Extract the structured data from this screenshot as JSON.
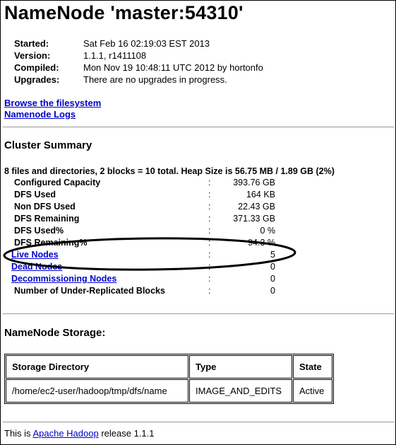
{
  "title": "NameNode 'master:54310'",
  "info": [
    {
      "key": "Started:",
      "value": "Sat Feb 16 02:19:03 EST 2013"
    },
    {
      "key": "Version:",
      "value": "1.1.1, r1411108"
    },
    {
      "key": "Compiled:",
      "value": "Mon Nov 19 10:48:11 UTC 2012 by hortonfo"
    },
    {
      "key": "Upgrades:",
      "value": "There are no upgrades in progress."
    }
  ],
  "links": {
    "browse": "Browse the filesystem",
    "logs": "Namenode Logs"
  },
  "cluster_summary": {
    "heading": "Cluster Summary",
    "summary_line": "8 files and directories, 2 blocks = 10 total. Heap Size is 56.75 MB / 1.89 GB (2%)",
    "separator": ":",
    "rows": [
      {
        "label": "Configured Capacity",
        "value": "393.76 GB"
      },
      {
        "label": "DFS Used",
        "value": "164 KB"
      },
      {
        "label": "Non DFS Used",
        "value": "22.43 GB"
      },
      {
        "label": "DFS Remaining",
        "value": "371.33 GB"
      },
      {
        "label": "DFS Used%",
        "value": "0 %"
      },
      {
        "label": "DFS Remaining%",
        "value": "94.3 %"
      },
      {
        "label": "Live Nodes",
        "value": "5"
      },
      {
        "label": "Dead Nodes",
        "value": "0"
      },
      {
        "label": "Decommissioning Nodes",
        "value": "0"
      },
      {
        "label": "Number of Under-Replicated Blocks",
        "value": "0"
      }
    ]
  },
  "storage": {
    "heading": "NameNode Storage:",
    "headers": [
      "Storage Directory",
      "Type",
      "State"
    ],
    "rows": [
      [
        "/home/ec2-user/hadoop/tmp/dfs/name",
        "IMAGE_AND_EDITS",
        "Active"
      ]
    ]
  },
  "footer": {
    "prefix": "This is ",
    "link": "Apache Hadoop",
    "suffix": " release 1.1.1"
  }
}
